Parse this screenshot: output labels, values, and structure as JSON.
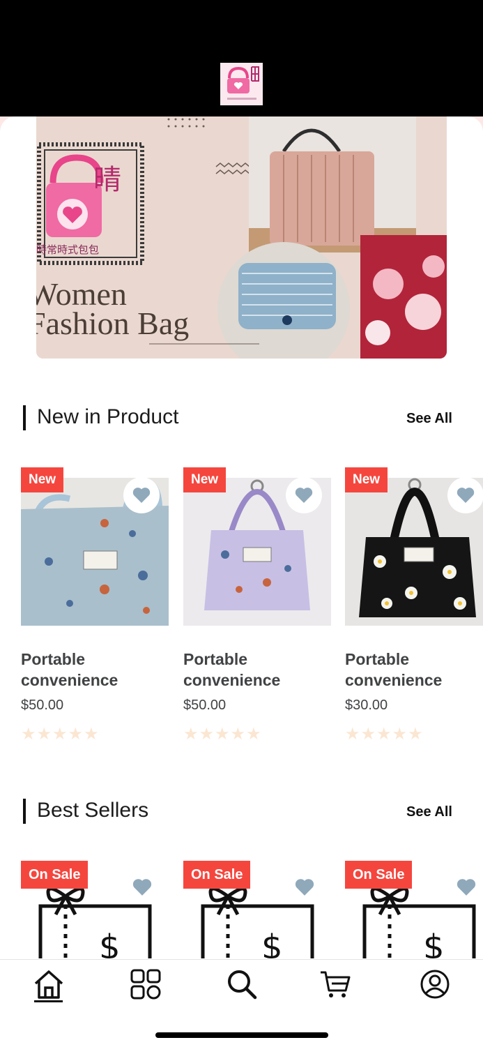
{
  "banner": {
    "line1": "Women",
    "line2": "Fashion Bag",
    "brand_char": "晴",
    "brand_sub": "時常時式包包"
  },
  "sections": {
    "new": {
      "title": "New in Product",
      "see_all": "See All"
    },
    "best": {
      "title": "Best Sellers",
      "see_all": "See All"
    }
  },
  "new_products": [
    {
      "badge": "New",
      "name": "Portable convenience",
      "price": "$50.00",
      "rating": 0,
      "stars": "★★★★★"
    },
    {
      "badge": "New",
      "name": "Portable convenience",
      "price": "$50.00",
      "rating": 0,
      "stars": "★★★★★"
    },
    {
      "badge": "New",
      "name": "Portable convenience",
      "price": "$30.00",
      "rating": 0,
      "stars": "★★★★★"
    }
  ],
  "best_sellers": [
    {
      "badge": "On Sale"
    },
    {
      "badge": "On Sale"
    },
    {
      "badge": "On Sale"
    }
  ],
  "tabbar": {
    "items": [
      "home-icon",
      "categories-icon",
      "search-icon",
      "cart-icon",
      "profile-icon"
    ],
    "active": "home-icon"
  },
  "colors": {
    "badge": "#f5463e",
    "heart": "#8fa9bb",
    "star_empty": "#fbe6d2",
    "brand_pink": "#e8458a"
  }
}
